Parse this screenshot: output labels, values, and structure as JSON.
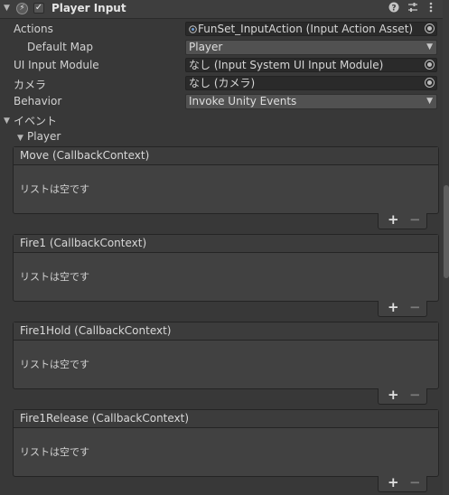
{
  "component": {
    "title": "Player Input"
  },
  "properties": {
    "actions": {
      "label": "Actions",
      "value": "FunSet_InputAction (Input Action Asset)"
    },
    "default_map": {
      "label": "Default Map",
      "value": "Player"
    },
    "ui_input_module": {
      "label": "UI Input Module",
      "value": "なし (Input System UI Input Module)"
    },
    "camera": {
      "label": "カメラ",
      "value": "なし (カメラ)"
    },
    "behavior": {
      "label": "Behavior",
      "value": "Invoke Unity Events"
    }
  },
  "events": {
    "label": "イベント",
    "group_label": "Player",
    "items": [
      {
        "title": "Move (CallbackContext)",
        "empty": "リストは空です"
      },
      {
        "title": "Fire1 (CallbackContext)",
        "empty": "リストは空です"
      },
      {
        "title": "Fire1Hold (CallbackContext)",
        "empty": "リストは空です"
      },
      {
        "title": "Fire1Release (CallbackContext)",
        "empty": "リストは空です"
      }
    ],
    "add_label": "+",
    "remove_label": "−"
  },
  "icons": {
    "foldout": "triangle-down-icon",
    "component": "player-input-icon",
    "help": "help-icon",
    "presets": "presets-icon",
    "menu": "kebab-menu-icon",
    "picker": "object-picker-icon",
    "asset": "input-action-asset-icon"
  },
  "colors": {
    "background": "#383838",
    "field": "#2a2a2a",
    "text": "#d2d2d2"
  }
}
